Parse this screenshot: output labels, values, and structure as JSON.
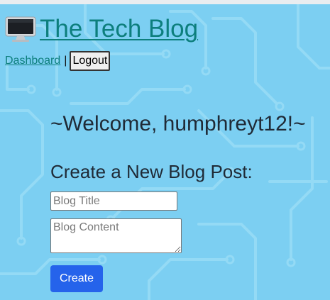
{
  "header": {
    "icon": "desktop-computer-icon",
    "title": "The Tech Blog"
  },
  "nav": {
    "dashboard_label": "Dashboard",
    "separator": "|",
    "logout_label": "Logout"
  },
  "main": {
    "welcome": "~Welcome, humphreyt12!~",
    "form_heading": "Create a New Blog Post:",
    "title_placeholder": "Blog Title",
    "content_placeholder": "Blog Content",
    "create_label": "Create"
  },
  "colors": {
    "background": "#7ccff2",
    "link": "#0d7f7d",
    "primary_button": "#2563eb"
  }
}
